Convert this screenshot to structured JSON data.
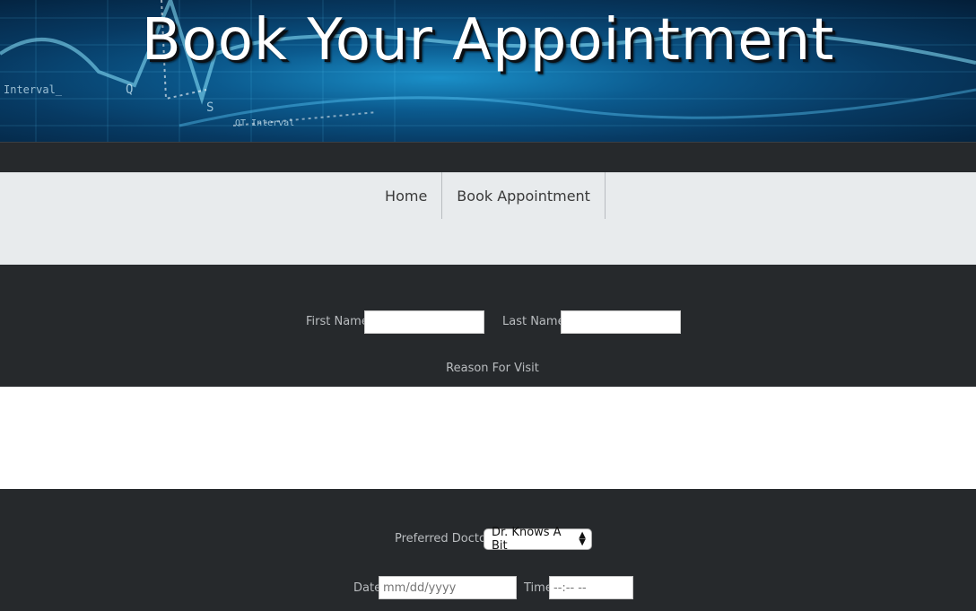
{
  "header": {
    "title": "Book Your Appointment"
  },
  "nav": {
    "items": [
      {
        "label": "Home"
      },
      {
        "label": "Book Appointment"
      }
    ]
  },
  "form": {
    "first_name": {
      "label": "First Name",
      "value": ""
    },
    "last_name": {
      "label": "Last Name",
      "value": ""
    },
    "reason": {
      "label": "Reason For Visit",
      "value": ""
    },
    "doctor": {
      "label": "Preferred Doctor",
      "selected": "Dr. Knows A Bit"
    },
    "date": {
      "label": "Date",
      "placeholder": "mm/dd/yyyy"
    },
    "time": {
      "label": "Time",
      "placeholder": "--:-- --"
    }
  },
  "hero_decor": {
    "texts": [
      "Interval_",
      "Q",
      "S",
      "QT Interval"
    ]
  },
  "colors": {
    "dark_bg": "#26292c",
    "nav_bg": "#e8ebed",
    "label": "#b9bcbf"
  }
}
